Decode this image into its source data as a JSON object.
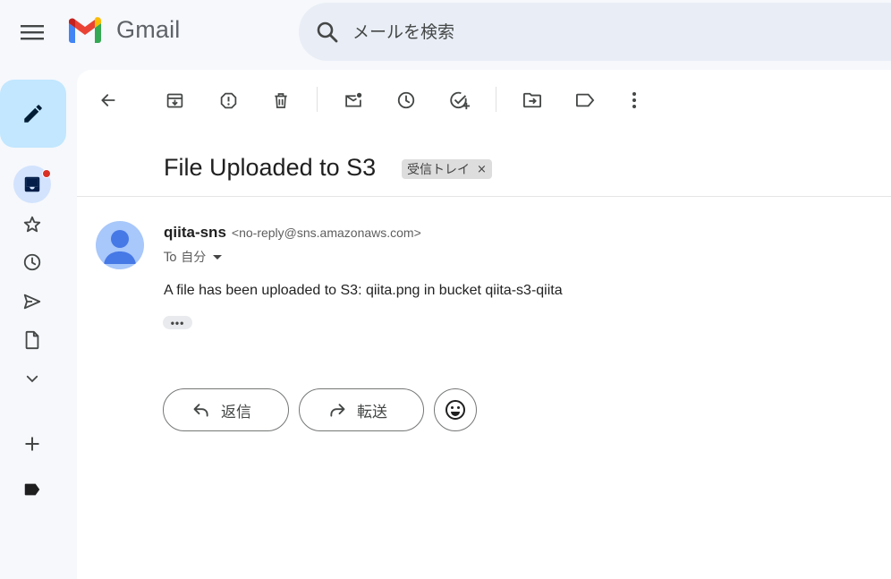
{
  "header": {
    "app_name": "Gmail",
    "search_placeholder": "メールを検索"
  },
  "sidebar": {
    "items": [
      {
        "name": "inbox",
        "icon": "inbox-icon",
        "active": true,
        "has_dot": true
      },
      {
        "name": "starred",
        "icon": "star-icon"
      },
      {
        "name": "snoozed",
        "icon": "clock-icon"
      },
      {
        "name": "sent",
        "icon": "send-icon"
      },
      {
        "name": "drafts",
        "icon": "draft-icon"
      },
      {
        "name": "more",
        "icon": "chevron-down-icon"
      },
      {
        "name": "create-label",
        "icon": "plus-icon"
      },
      {
        "name": "label",
        "icon": "label-icon"
      }
    ]
  },
  "toolbar": {
    "buttons": [
      "back-icon",
      "archive-icon",
      "report-spam-icon",
      "delete-icon",
      "mark-unread-icon",
      "snooze-icon",
      "add-task-icon",
      "move-to-icon",
      "labels-icon",
      "more-vert-icon"
    ]
  },
  "message": {
    "subject": "File Uploaded to S3",
    "label": "受信トレイ",
    "label_remove": "×",
    "sender_name": "qiita-sns",
    "sender_email": "<no-reply@sns.amazonaws.com>",
    "to": "To 自分",
    "body": "A file has been uploaded to S3: qiita.png in bucket qiita-s3-qiita",
    "more": "•••"
  },
  "actions": {
    "reply_label": "返信",
    "forward_label": "転送"
  },
  "colors": {
    "background": "#f6f8fc",
    "compose": "#c2e7ff",
    "search": "#e9eef6",
    "active_nav": "#d3e3fd",
    "notification_dot": "#d93025",
    "avatar": "#a8c7fa"
  }
}
